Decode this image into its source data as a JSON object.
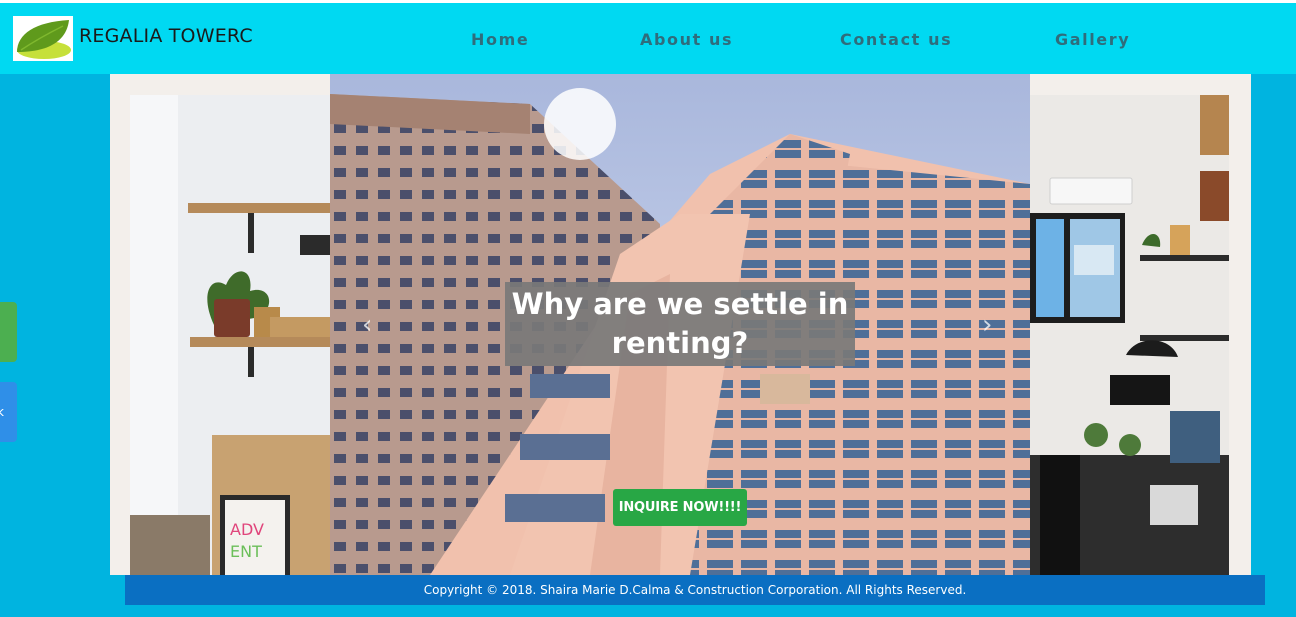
{
  "brand": {
    "name": "REGALIA TOWERC",
    "logo_icon": "leaf-logo-icon"
  },
  "nav": {
    "items": [
      {
        "label": "Home"
      },
      {
        "label": "About us"
      },
      {
        "label": "Contact us"
      },
      {
        "label": "Gallery"
      }
    ]
  },
  "carousel": {
    "caption": "Why are we settle in renting?",
    "cta_label": "INQUIRE NOW!!!!",
    "prev_icon": "chevron-left-icon",
    "next_icon": "chevron-right-icon",
    "prev_glyph": "‹",
    "next_glyph": "›"
  },
  "side_tabs": {
    "blue_glyph": "k"
  },
  "footer": {
    "copyright": "Copyright © 2018. Shaira Marie D.Calma & Construction Corporation. All Rights Reserved."
  },
  "colors": {
    "page_background": "#00b4e0",
    "navbar": "#00d9f2",
    "nav_text": "#2f6d7c",
    "footer": "#0a6fc2",
    "cta": "#28a745",
    "caption_box": "#787878"
  }
}
